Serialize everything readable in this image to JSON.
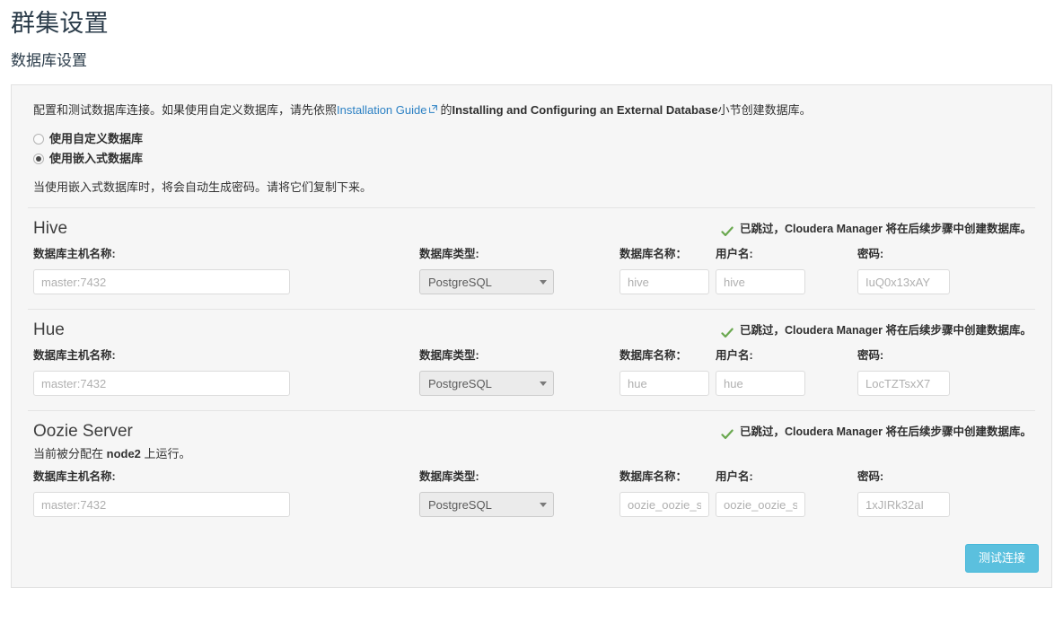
{
  "page": {
    "title": "群集设置",
    "section_title": "数据库设置"
  },
  "intro": {
    "text_before_link": "配置和测试数据库连接。如果使用自定义数据库，请先依照",
    "link_text": "Installation Guide",
    "link_icon": "external-link-icon",
    "text_after_link": "的",
    "bold_text": "Installing and Configuring an External Database",
    "text_end": "小节创建数据库。"
  },
  "database_mode": {
    "options": [
      {
        "label": "使用自定义数据库",
        "selected": false
      },
      {
        "label": "使用嵌入式数据库",
        "selected": true
      }
    ],
    "note": "当使用嵌入式数据库时，将会自动生成密码。请将它们复制下来。"
  },
  "field_labels": {
    "host": "数据库主机名称:",
    "type": "数据库类型:",
    "name": "数据库名称：",
    "user": "用户名:",
    "password": "密码:"
  },
  "status_text": "已跳过，Cloudera Manager 将在后续步骤中创建数据库。",
  "status_icon": "check-icon",
  "status_color": "#6aa84f",
  "services": [
    {
      "name": "Hive",
      "status": "已跳过，Cloudera Manager 将在后续步骤中创建数据库。",
      "assignment_note": null,
      "host": "master:7432",
      "db_type": "PostgreSQL",
      "db_name": "hive",
      "username": "hive",
      "password": "IuQ0x13xAY"
    },
    {
      "name": "Hue",
      "status": "已跳过，Cloudera Manager 将在后续步骤中创建数据库。",
      "assignment_note": null,
      "host": "master:7432",
      "db_type": "PostgreSQL",
      "db_name": "hue",
      "username": "hue",
      "password": "LocTZTsxX7"
    },
    {
      "name": "Oozie Server",
      "status": "已跳过，Cloudera Manager 将在后续步骤中创建数据库。",
      "assignment_note_prefix": "当前被分配在 ",
      "assignment_note_host": "node2",
      "assignment_note_suffix": " 上运行。",
      "host": "master:7432",
      "db_type": "PostgreSQL",
      "db_name": "oozie_oozie_se",
      "username": "oozie_oozie_se",
      "password": "1xJIRk32aI"
    }
  ],
  "footer": {
    "test_button": "测试连接",
    "button_color": "#5bc0de"
  }
}
